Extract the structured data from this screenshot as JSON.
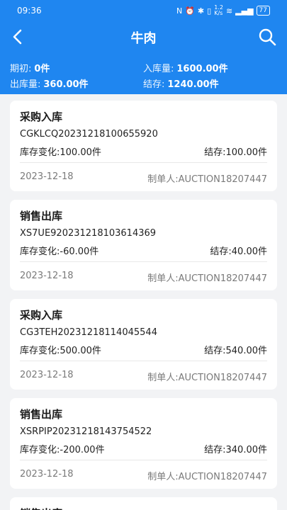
{
  "status_bar": {
    "time": "09:36",
    "icons": [
      "nfc-icon",
      "alarm-icon",
      "bluetooth-icon",
      "vibrate-icon",
      "wifi-icon",
      "signal-icon"
    ],
    "network_speed": "1.2\nK/s",
    "battery": "77"
  },
  "header": {
    "title": "牛肉",
    "back_icon": "back-arrow-icon",
    "search_icon": "search-icon",
    "accent_color": "#1f86f0"
  },
  "summary": {
    "opening_label": "期初:",
    "opening_value": "0件",
    "inbound_label": "入库量:",
    "inbound_value": "1600.00件",
    "outbound_label": "出库量:",
    "outbound_value": "360.00件",
    "balance_label": "结存:",
    "balance_value": "1240.00件"
  },
  "records": [
    {
      "type": "采购入库",
      "code": "CGKLCQ20231218100655920",
      "change_label": "库存变化:",
      "change": "100.00件",
      "balance_label": "结存:",
      "balance": "100.00件",
      "date": "2023-12-18",
      "maker_label": "制单人:",
      "maker": "AUCTION18207447"
    },
    {
      "type": "销售出库",
      "code": "XS7UE920231218103614369",
      "change_label": "库存变化:",
      "change": "-60.00件",
      "balance_label": "结存:",
      "balance": "40.00件",
      "date": "2023-12-18",
      "maker_label": "制单人:",
      "maker": "AUCTION18207447"
    },
    {
      "type": "采购入库",
      "code": "CG3TEH20231218114045544",
      "change_label": "库存变化:",
      "change": "500.00件",
      "balance_label": "结存:",
      "balance": "540.00件",
      "date": "2023-12-18",
      "maker_label": "制单人:",
      "maker": "AUCTION18207447"
    },
    {
      "type": "销售出库",
      "code": "XSRPIP20231218143754522",
      "change_label": "库存变化:",
      "change": "-200.00件",
      "balance_label": "结存:",
      "balance": "340.00件",
      "date": "2023-12-18",
      "maker_label": "制单人:",
      "maker": "AUCTION18207447"
    },
    {
      "type": "销售出库"
    }
  ]
}
